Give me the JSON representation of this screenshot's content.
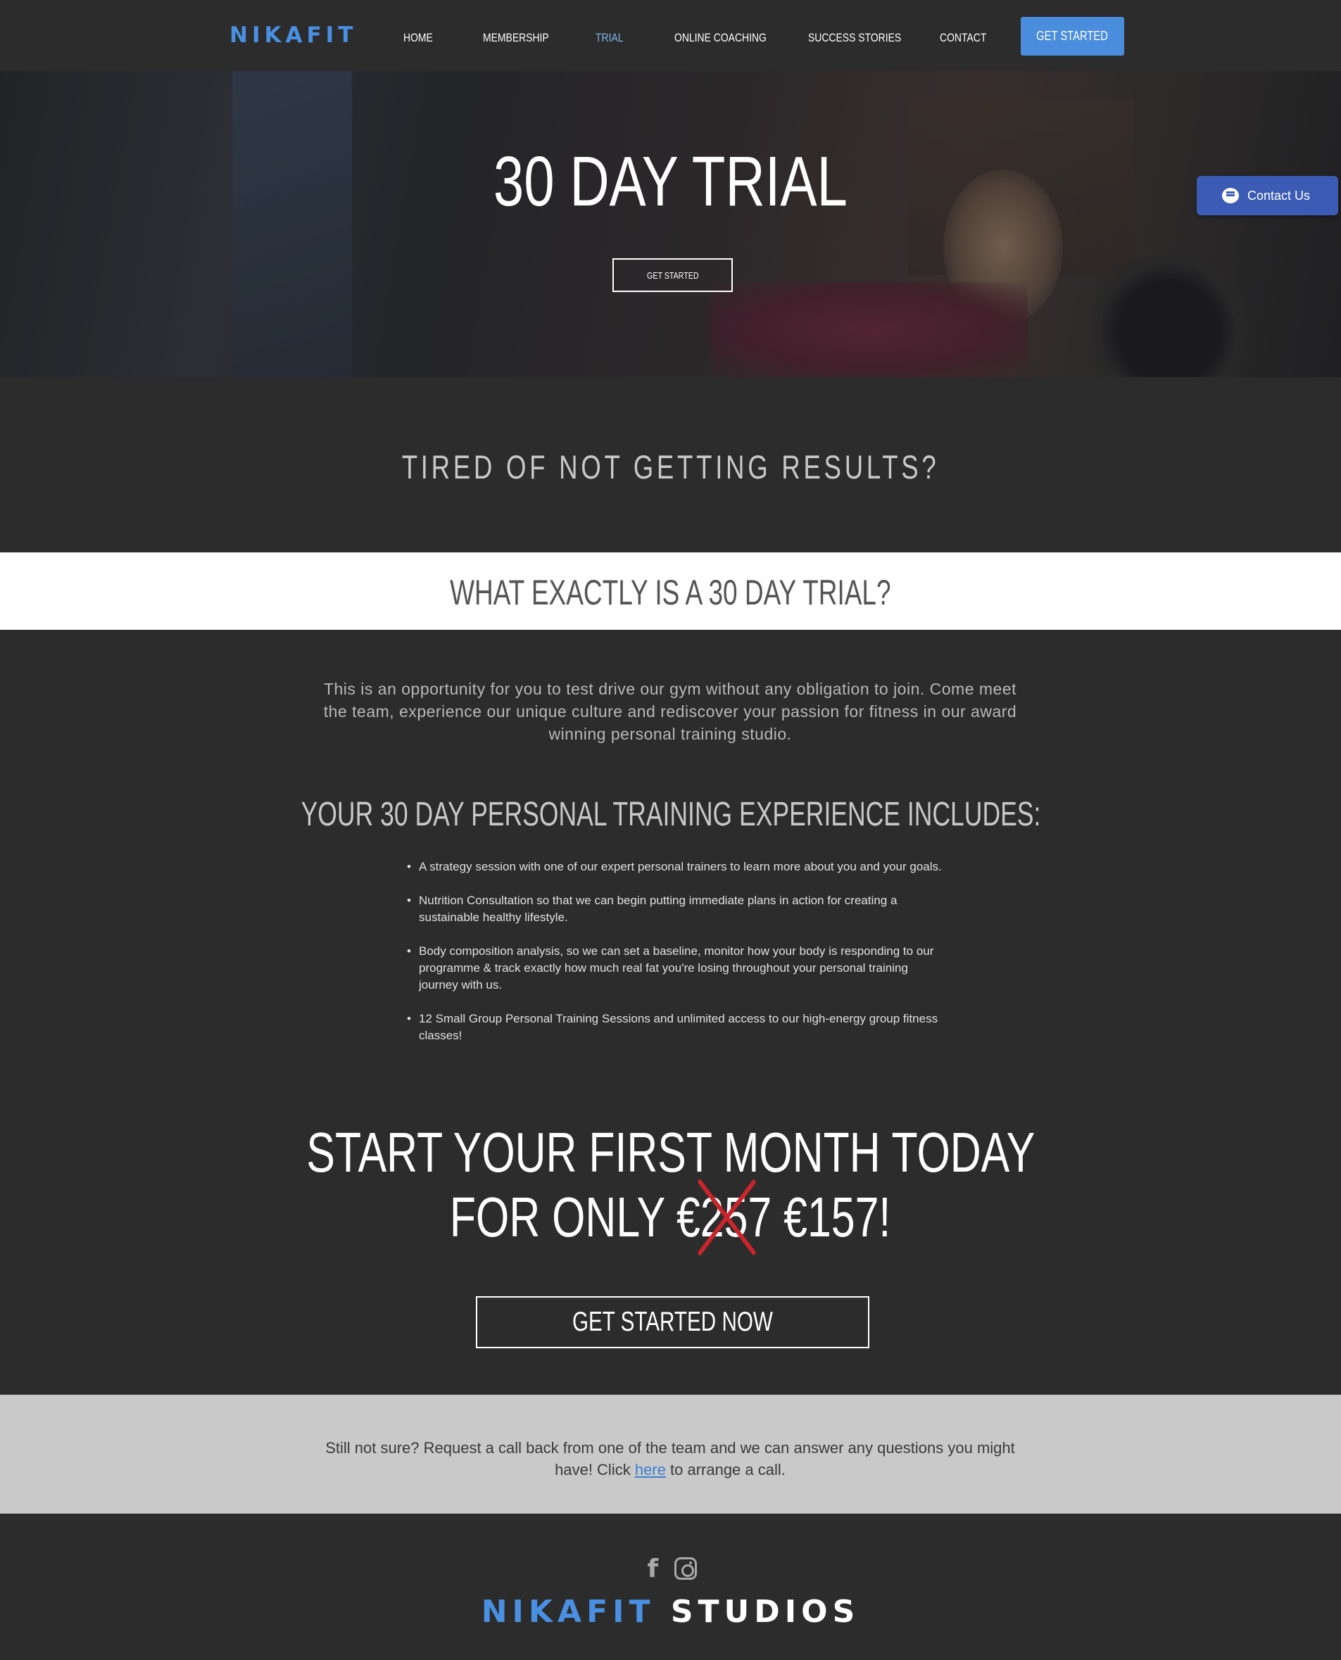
{
  "header": {
    "logo": "NIKAFIT",
    "nav": [
      {
        "label": "HOME",
        "active": false
      },
      {
        "label": "MEMBERSHIP",
        "active": false
      },
      {
        "label": "TRIAL",
        "active": true
      },
      {
        "label": "ONLINE COACHING",
        "active": false
      },
      {
        "label": "SUCCESS STORIES",
        "active": false
      },
      {
        "label": "CONTACT",
        "active": false
      }
    ],
    "cta_label": "GET STARTED"
  },
  "hero": {
    "title": "30 DAY TRIAL",
    "button_label": "GET STARTED"
  },
  "contact_chip": {
    "label": "Contact Us",
    "icon": "chat-bubble-icon"
  },
  "tired": {
    "title": "TIRED OF NOT GETTING RESULTS?"
  },
  "band": {
    "title": "WHAT EXACTLY IS A 30 DAY TRIAL?"
  },
  "main": {
    "intro": "This is an opportunity for you to test drive our gym without any obligation to join. Come meet the team, experience our unique culture and rediscover your passion for fitness in our award winning personal training studio.",
    "includes_title": "YOUR 30 DAY PERSONAL TRAINING EXPERIENCE INCLUDES:",
    "items": [
      "A strategy session with one of our expert personal trainers to learn more about you and your goals.",
      "Nutrition Consultation so that we can begin putting immediate plans in action for creating a sustainable healthy lifestyle.",
      "Body composition analysis, so we can set a baseline, monitor how your body is responding to our programme & track exactly how much real fat you're losing throughout your personal training journey with us.",
      "12 Small Group Personal Training Sessions and unlimited access to our high-energy group fitness classes!"
    ],
    "offer_line1": "START YOUR FIRST MONTH TODAY",
    "offer_prefix": "FOR ONLY",
    "offer_old_price": "€257",
    "offer_new_price": "€157!",
    "cta_label": "GET STARTED NOW"
  },
  "callback": {
    "text_before": "Still not sure? Request a call back from one of the team and we can answer any questions you might have! Click",
    "link_text": "here",
    "text_after": "to arrange a call."
  },
  "footer": {
    "social": [
      "facebook-icon",
      "instagram-icon"
    ],
    "brand_blue": "NIKAFIT",
    "brand_white": "STUDIOS"
  },
  "colors": {
    "background": "#2c2c2c",
    "accent": "#4a90e2",
    "chip": "#3b5bb5",
    "strike": "#c9252b",
    "grey_band": "#c9c9c9"
  }
}
